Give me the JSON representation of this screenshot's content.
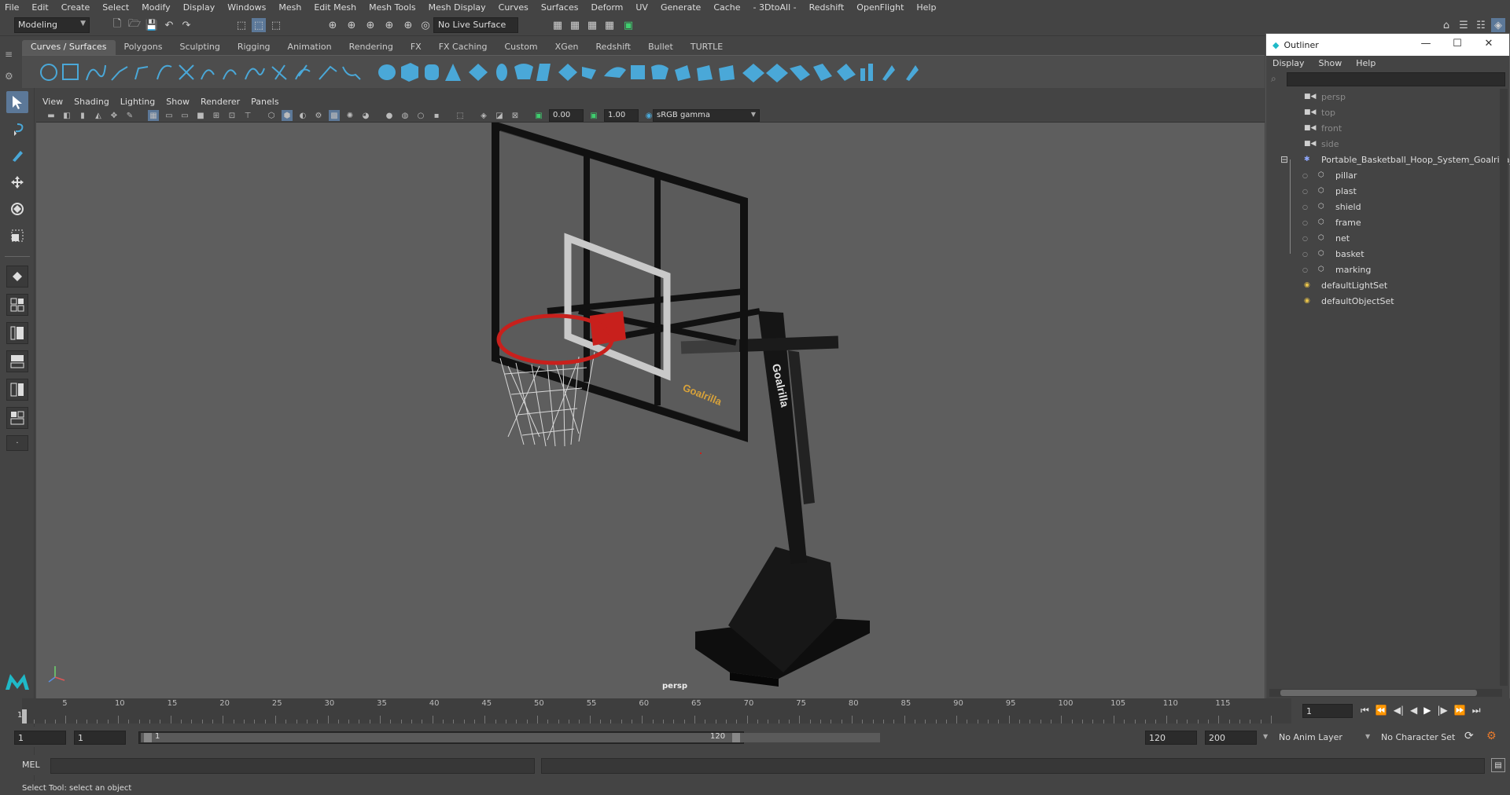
{
  "menubar": [
    "File",
    "Edit",
    "Create",
    "Select",
    "Modify",
    "Display",
    "Windows",
    "Mesh",
    "Edit Mesh",
    "Mesh Tools",
    "Mesh Display",
    "Curves",
    "Surfaces",
    "Deform",
    "UV",
    "Generate",
    "Cache",
    "- 3DtoAll -",
    "Redshift",
    "OpenFlight",
    "Help"
  ],
  "status": {
    "mode": "Modeling",
    "live_surface": "No Live Surface"
  },
  "shelf_tabs": [
    "Curves / Surfaces",
    "Polygons",
    "Sculpting",
    "Rigging",
    "Animation",
    "Rendering",
    "FX",
    "FX Caching",
    "Custom",
    "XGen",
    "Redshift",
    "Bullet",
    "TURTLE"
  ],
  "panel_menu": [
    "View",
    "Shading",
    "Lighting",
    "Show",
    "Renderer",
    "Panels"
  ],
  "panel_bar": {
    "exposure": "0.00",
    "gamma": "1.00",
    "color_space": "sRGB gamma"
  },
  "viewport": {
    "camera_label": "persp",
    "brand_text": "Goalrilla"
  },
  "outliner": {
    "title": "Outliner",
    "menu": [
      "Display",
      "Show",
      "Help"
    ],
    "items": [
      {
        "label": "persp",
        "dim": true,
        "icon": "camera-icon",
        "level": 0
      },
      {
        "label": "top",
        "dim": true,
        "icon": "camera-icon",
        "level": 0
      },
      {
        "label": "front",
        "dim": true,
        "icon": "camera-icon",
        "level": 0
      },
      {
        "label": "side",
        "dim": true,
        "icon": "camera-icon",
        "level": 0
      },
      {
        "label": "Portable_Basketball_Hoop_System_Goalrilla_",
        "dim": false,
        "icon": "group-icon",
        "level": 0
      },
      {
        "label": "pillar",
        "dim": false,
        "icon": "mesh-icon",
        "level": 1
      },
      {
        "label": "plast",
        "dim": false,
        "icon": "mesh-icon",
        "level": 1
      },
      {
        "label": "shield",
        "dim": false,
        "icon": "mesh-icon",
        "level": 1
      },
      {
        "label": "frame",
        "dim": false,
        "icon": "mesh-icon",
        "level": 1
      },
      {
        "label": "net",
        "dim": false,
        "icon": "mesh-icon",
        "level": 1
      },
      {
        "label": "basket",
        "dim": false,
        "icon": "mesh-icon",
        "level": 1
      },
      {
        "label": "marking",
        "dim": false,
        "icon": "mesh-icon",
        "level": 1
      },
      {
        "label": "defaultLightSet",
        "dim": false,
        "icon": "set-icon",
        "level": 0
      },
      {
        "label": "defaultObjectSet",
        "dim": false,
        "icon": "set-icon",
        "level": 0
      }
    ]
  },
  "timeline": {
    "ticks": [
      "5",
      "10",
      "15",
      "20",
      "25",
      "30",
      "35",
      "40",
      "45",
      "50",
      "55",
      "60",
      "65",
      "70",
      "75",
      "80",
      "85",
      "90",
      "95",
      "100",
      "105",
      "110",
      "115"
    ],
    "start_label": "1",
    "current_frame": "1"
  },
  "range": {
    "start": "1",
    "anim_start": "1",
    "range_start": "1",
    "range_end": "120",
    "anim_end": "120",
    "end": "200",
    "anim_layer": "No Anim Layer",
    "character_set": "No Character Set"
  },
  "cmd": {
    "label": "MEL"
  },
  "help_line": "Select Tool: select an object",
  "colors": {
    "accent": "#5c7898",
    "shelf_icon": "#4aa8d8",
    "rim": "#c8201c"
  }
}
